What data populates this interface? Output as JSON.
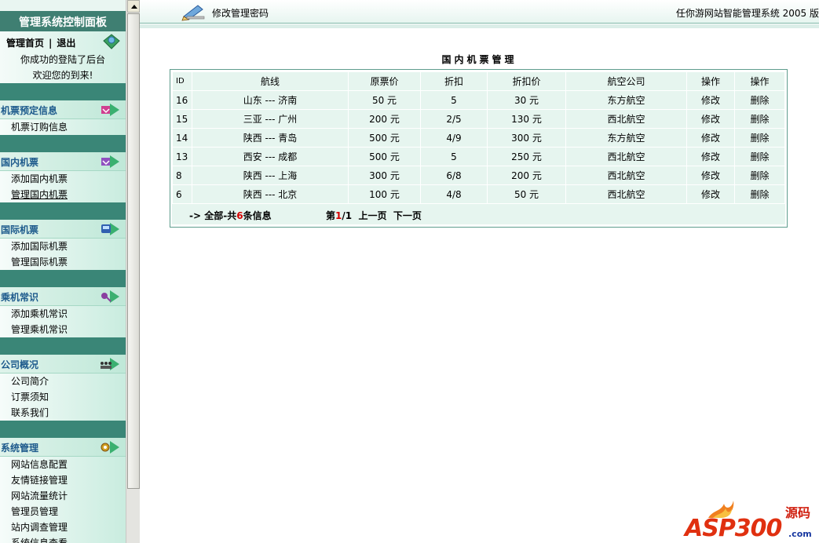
{
  "sidebar": {
    "title": "管理系统控制面板",
    "home_label": "管理首页",
    "separator": "|",
    "logout_label": "退出",
    "welcome_line1": "你成功的登陆了后台",
    "welcome_line2": "欢迎您的到来!",
    "sections": [
      {
        "header": "机票预定信息",
        "items": [
          "机票订购信息"
        ]
      },
      {
        "header": "国内机票",
        "items": [
          "添加国内机票",
          "管理国内机票"
        ]
      },
      {
        "header": "国际机票",
        "items": [
          "添加国际机票",
          "管理国际机票"
        ]
      },
      {
        "header": "乘机常识",
        "items": [
          "添加乘机常识",
          "管理乘机常识"
        ]
      },
      {
        "header": "公司概况",
        "items": [
          "公司简介",
          "订票须知",
          "联系我们"
        ]
      },
      {
        "header": "系统管理",
        "items": [
          "网站信息配置",
          "友情链接管理",
          "网站流量统计",
          "管理员管理",
          "站内调查管理",
          "系统信息查看"
        ]
      }
    ]
  },
  "header": {
    "page_title": "修改管理密码",
    "system_name": "任你游网站智能管理系统 2005 版"
  },
  "main": {
    "title": "国内机票管理",
    "columns": [
      "ID",
      "航线",
      "原票价",
      "折扣",
      "折扣价",
      "航空公司",
      "操作",
      "操作"
    ],
    "rows": [
      {
        "id": "16",
        "route": "山东 --- 济南",
        "price": "50 元",
        "discount": "5",
        "discount_price": "30 元",
        "airline": "东方航空",
        "edit": "修改",
        "delete": "删除"
      },
      {
        "id": "15",
        "route": "三亚 --- 广州",
        "price": "200 元",
        "discount": "2/5",
        "discount_price": "130 元",
        "airline": "西北航空",
        "edit": "修改",
        "delete": "删除"
      },
      {
        "id": "14",
        "route": "陕西 --- 青岛",
        "price": "500 元",
        "discount": "4/9",
        "discount_price": "300 元",
        "airline": "东方航空",
        "edit": "修改",
        "delete": "删除"
      },
      {
        "id": "13",
        "route": "西安 --- 成都",
        "price": "500 元",
        "discount": "5",
        "discount_price": "250 元",
        "airline": "西北航空",
        "edit": "修改",
        "delete": "删除"
      },
      {
        "id": "8",
        "route": "陕西 --- 上海",
        "price": "300 元",
        "discount": "6/8",
        "discount_price": "200 元",
        "airline": "西北航空",
        "edit": "修改",
        "delete": "删除"
      },
      {
        "id": "6",
        "route": "陕西 --- 北京",
        "price": "100 元",
        "discount": "4/8",
        "discount_price": "50 元",
        "airline": "西北航空",
        "edit": "修改",
        "delete": "删除"
      }
    ],
    "pager": {
      "prefix": "-> 全部-共",
      "total": "6",
      "suffix": "条信息",
      "page_prefix": "第",
      "current_page": "1",
      "page_suffix": "/1",
      "prev_label": "上一页",
      "next_label": "下一页"
    }
  },
  "logo": {
    "text": "ASP300",
    "cn": "源码",
    "domain": ".com"
  },
  "colors": {
    "sidebar_bg": "#3a8677",
    "section_header_text": "#1d5a8c",
    "table_cell_bg": "#e6f5ef",
    "table_border": "#5e9d8d",
    "highlight_red": "#d40000"
  }
}
